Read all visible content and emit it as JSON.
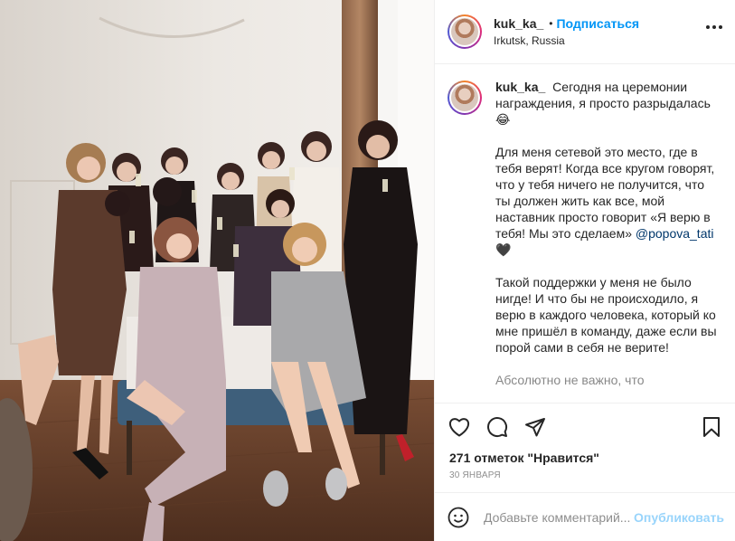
{
  "post": {
    "photo_alt": "",
    "author": {
      "username": "kuk_ka_",
      "follow_label": "Подписаться",
      "separator": "•",
      "location": "Irkutsk, Russia"
    },
    "caption": {
      "username": "kuk_ka_",
      "paragraphs": [
        "Сегодня на церемонии награждения, я просто разрыдалась 😂",
        "Для меня сетевой это место, где в тебя верят! Когда все кругом говорят, что у тебя ничего не получится, что ты должен жить как все, мой наставник просто говорит «Я верю в тебя! Мы это сделаем»",
        "Такой поддержки у меня не было нигде! И что бы не происходило, я верю в каждого человека, который ко мне пришёл в команду, даже если вы порой сами в себя не верите!",
        "Абсолютно не важно, что"
      ],
      "mention": "@popova_tati",
      "heart": "🖤"
    },
    "actions": {
      "like_icon": "heart-icon",
      "comment_icon": "comment-icon",
      "share_icon": "share-icon",
      "save_icon": "bookmark-icon"
    },
    "likes_text": "271 отметок \"Нравится\"",
    "date_text": "30 ЯНВАРЯ",
    "comment": {
      "emoji_icon": "emoji-icon",
      "placeholder": "Добавьте комментарий...",
      "publish_label": "Опубликовать"
    }
  },
  "colors": {
    "accent": "#0095f6",
    "text": "#262626",
    "muted": "#8e8e8e",
    "border": "#efefef"
  }
}
